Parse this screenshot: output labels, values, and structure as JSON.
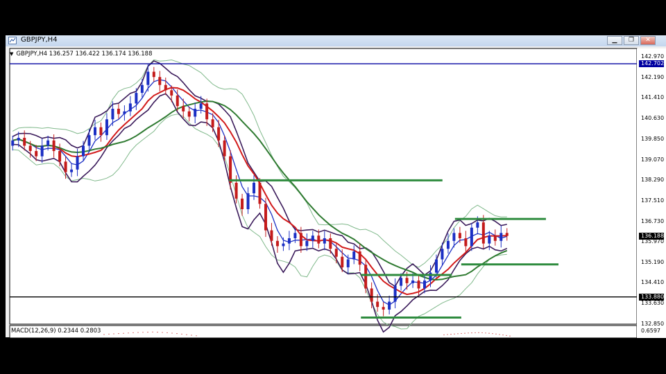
{
  "window": {
    "title": "GBPJPY,H4",
    "buttons": {
      "minimize": "▁",
      "restore": "❐",
      "close": "✕"
    }
  },
  "info": {
    "symbol": "GBPJPY,H4",
    "ohlc": "136.257 136.422 136.174 136.188"
  },
  "macd": {
    "label": "MACD(12,26,9) 0.2344 0.2803",
    "level": "0.6597"
  },
  "chart_data": {
    "type": "candlestick",
    "ylim": [
      132.85,
      143.28
    ],
    "price_labels": [
      "142.970",
      "142.190",
      "141.410",
      "140.630",
      "139.850",
      "139.070",
      "138.290",
      "137.510",
      "136.730",
      "135.970",
      "135.190",
      "134.410",
      "133.630",
      "132.850"
    ],
    "markers": [
      {
        "value": "142.702",
        "color": "#0000a0"
      },
      {
        "value": "136.188",
        "color": "#000000"
      },
      {
        "value": "133.880",
        "color": "#000000"
      }
    ],
    "hlines": [
      {
        "price": 142.702,
        "color": "#0000a0",
        "full": true
      },
      {
        "price": 133.88,
        "color": "#000000",
        "full": true
      },
      {
        "price": 138.29,
        "color": "#2e8b3e",
        "from": 0.35,
        "to": 0.69
      },
      {
        "price": 136.83,
        "color": "#2e8b3e",
        "from": 0.71,
        "to": 0.855
      },
      {
        "price": 135.11,
        "color": "#2e8b3e",
        "from": 0.72,
        "to": 0.875
      },
      {
        "price": 134.71,
        "color": "#2e8b3e",
        "from": 0.56,
        "to": 0.705
      },
      {
        "price": 133.1,
        "color": "#2e8b3e",
        "from": 0.56,
        "to": 0.72
      }
    ],
    "closes": [
      139.8,
      139.9,
      139.6,
      139.4,
      139.2,
      139.6,
      139.8,
      139.4,
      139.0,
      138.6,
      138.7,
      139.2,
      139.6,
      140.0,
      140.3,
      140.0,
      140.6,
      141.0,
      140.8,
      140.9,
      141.2,
      141.6,
      141.9,
      142.4,
      142.2,
      141.9,
      141.7,
      141.5,
      141.1,
      140.9,
      140.7,
      141.0,
      141.2,
      140.6,
      140.3,
      139.8,
      139.2,
      138.2,
      137.6,
      137.2,
      137.8,
      138.2,
      137.4,
      136.4,
      136.0,
      135.8,
      135.9,
      136.1,
      136.3,
      135.8,
      136.0,
      136.2,
      135.9,
      136.1,
      135.7,
      135.4,
      135.0,
      135.3,
      135.6,
      135.1,
      134.2,
      133.7,
      133.5,
      133.4,
      133.7,
      134.3,
      134.6,
      134.4,
      134.5,
      134.2,
      134.5,
      134.8,
      135.3,
      135.7,
      136.0,
      136.3,
      136.1,
      135.8,
      136.5,
      136.7,
      135.9,
      136.2,
      136.0,
      136.3,
      136.188
    ],
    "macd_hist": [
      0.25,
      0.28,
      0.3,
      0.32,
      0.34,
      0.36,
      0.38,
      0.4,
      0.41,
      0.42,
      0.43,
      0.42,
      0.4,
      0.38,
      0.35,
      0.32,
      0.28,
      0.24,
      0.2,
      0.16
    ]
  }
}
